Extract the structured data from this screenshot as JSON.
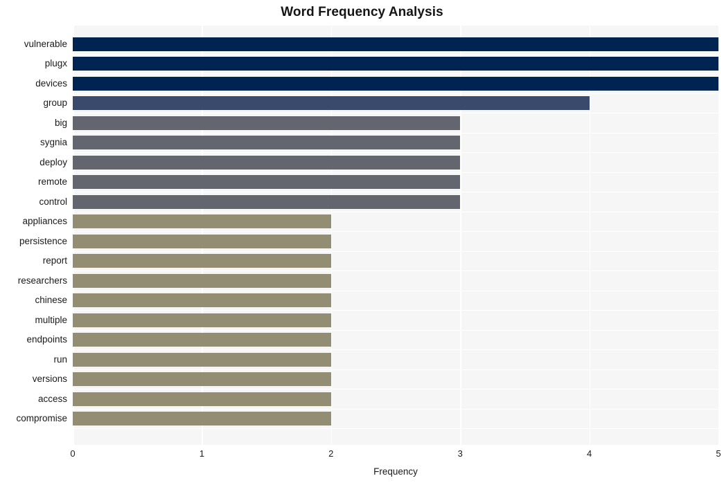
{
  "chart_data": {
    "type": "bar",
    "orientation": "horizontal",
    "title": "Word Frequency Analysis",
    "xlabel": "Frequency",
    "ylabel": "",
    "xlim": [
      0,
      5
    ],
    "xticks": [
      "0",
      "1",
      "2",
      "3",
      "4",
      "5"
    ],
    "grid": true,
    "legend": "none",
    "categories": [
      "vulnerable",
      "plugx",
      "devices",
      "group",
      "big",
      "sygnia",
      "deploy",
      "remote",
      "control",
      "appliances",
      "persistence",
      "report",
      "researchers",
      "chinese",
      "multiple",
      "endpoints",
      "run",
      "versions",
      "access",
      "compromise"
    ],
    "values": [
      5,
      5,
      5,
      4,
      3,
      3,
      3,
      3,
      3,
      2,
      2,
      2,
      2,
      2,
      2,
      2,
      2,
      2,
      2,
      2
    ],
    "bar_colors": [
      "#002452",
      "#002452",
      "#002452",
      "#3a4a6d",
      "#63666f",
      "#63666f",
      "#63666f",
      "#63666f",
      "#63666f",
      "#938d74",
      "#938d74",
      "#938d74",
      "#938d74",
      "#938d74",
      "#938d74",
      "#938d74",
      "#938d74",
      "#938d74",
      "#938d74",
      "#938d74"
    ]
  },
  "style": {
    "plot_background": "#f6f6f7",
    "gridline_color": "#ffffff",
    "figure_background": "#ffffff",
    "text_color": "#1a1a1a"
  }
}
